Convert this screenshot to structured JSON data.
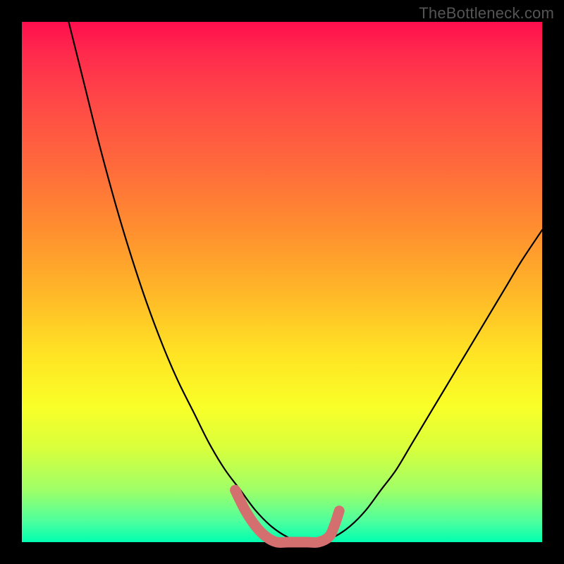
{
  "watermark": "TheBottleneck.com",
  "chart_data": {
    "type": "line",
    "title": "",
    "xlabel": "",
    "ylabel": "",
    "xlim": [
      0,
      100
    ],
    "ylim": [
      0,
      100
    ],
    "grid": false,
    "series": [
      {
        "name": "black-curve",
        "color": "#000000",
        "x": [
          9,
          12,
          15,
          18,
          21,
          24,
          27,
          30,
          33,
          36,
          39,
          42,
          45,
          48,
          51,
          54,
          57,
          60,
          63,
          66,
          69,
          72,
          75,
          78,
          81,
          84,
          87,
          90,
          93,
          96,
          100
        ],
        "values": [
          100,
          88,
          76,
          65,
          55,
          46,
          38,
          31,
          25,
          19,
          14,
          10,
          6,
          3,
          1,
          0,
          0,
          1,
          3,
          6,
          10,
          14,
          19,
          24,
          29,
          34,
          39,
          44,
          49,
          54,
          60
        ]
      },
      {
        "name": "pink-notch",
        "color": "#d36f6f",
        "x": [
          41,
          43,
          45,
          47,
          49,
          51,
          53,
          55,
          57,
          59,
          60,
          61
        ],
        "values": [
          10,
          6,
          3,
          1,
          0,
          0,
          0,
          0,
          0,
          1,
          3,
          6
        ]
      }
    ],
    "annotations": []
  },
  "colors": {
    "background": "#000000",
    "gradient_top": "#ff0e4d",
    "gradient_bottom": "#00ffb0",
    "curve_main": "#000000",
    "curve_notch": "#d36f6f",
    "watermark": "#555555"
  }
}
